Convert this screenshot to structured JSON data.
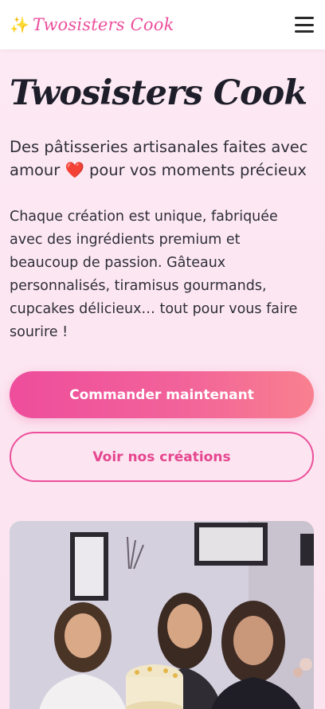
{
  "header": {
    "sparkle_icon": "sparkles-icon",
    "brand": "Twosisters Cook",
    "menu_icon": "hamburger-menu-icon"
  },
  "hero": {
    "title": "Twosisters Cook",
    "tagline_before": "Des pâtisseries artisanales faites avec amour",
    "tagline_emoji": "❤️",
    "tagline_after": "pour vos moments précieux",
    "description": "Chaque création est unique, fabriquée avec des ingrédients premium et beaucoup de passion. Gâteaux personnalisés, tiramisus gourmands, cupcakes délicieux… tout pour vous faire sourire !",
    "primary_button": "Commander maintenant",
    "secondary_button": "Voir nos créations"
  },
  "photo": {
    "subject": "three sisters holding a cake"
  },
  "colors": {
    "accent_pink": "#ec4f9c",
    "gradient_end": "#f8808f",
    "heart_red": "#e8233a"
  }
}
